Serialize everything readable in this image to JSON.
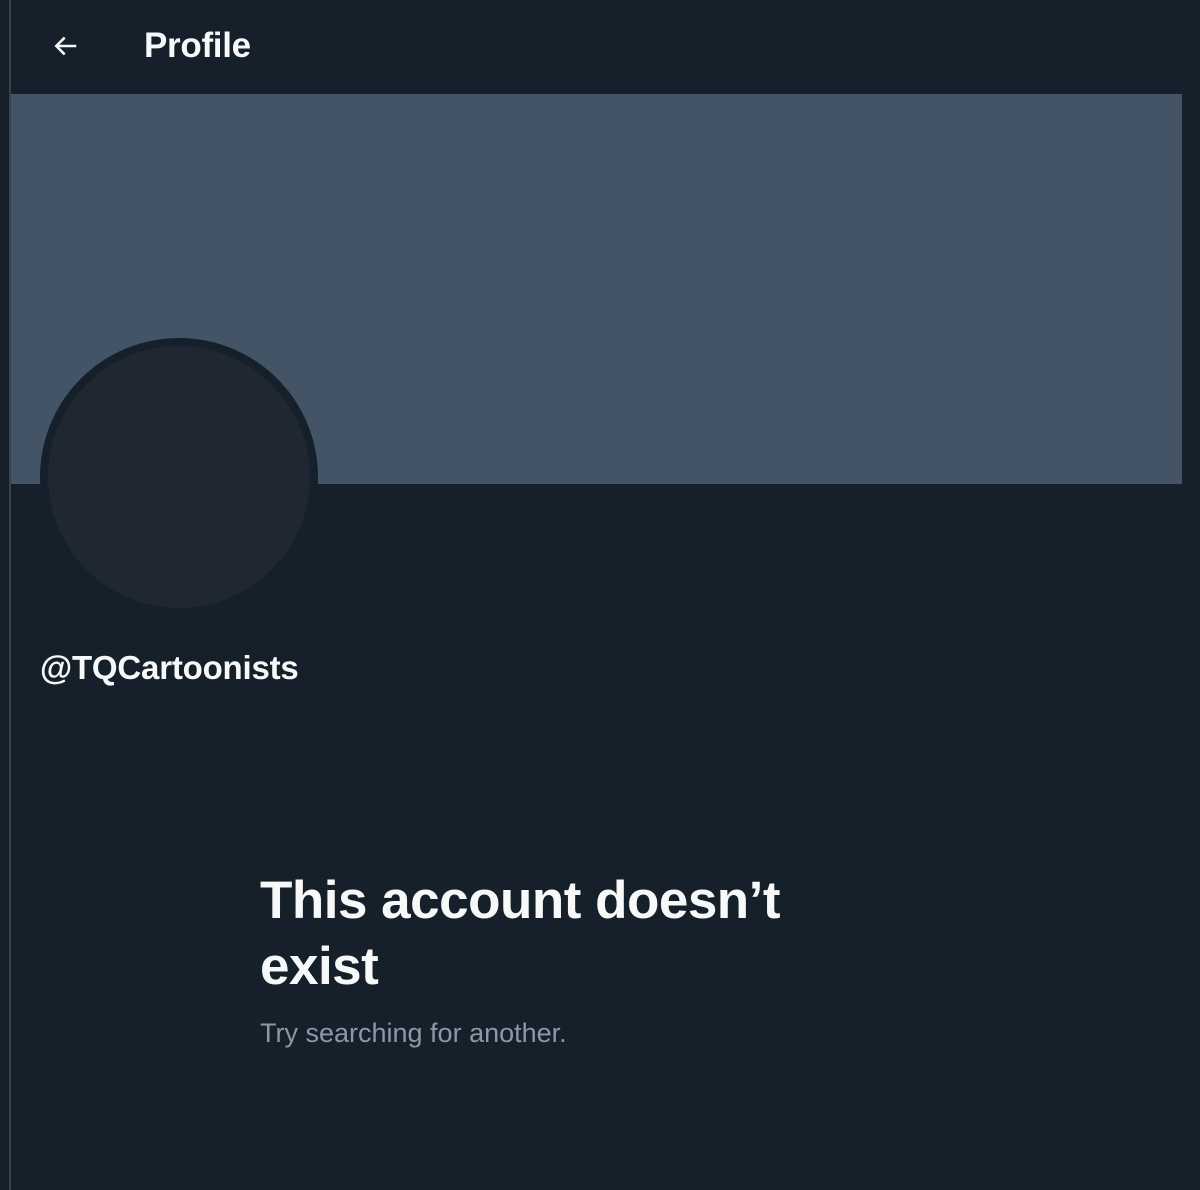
{
  "header": {
    "back_icon": "arrow-left-icon",
    "title": "Profile"
  },
  "profile": {
    "handle": "@TQCartoonists"
  },
  "empty_state": {
    "title": "This account doesn’t exist",
    "subtitle": "Try searching for another."
  },
  "colors": {
    "background": "#15202b",
    "banner": "#425466",
    "avatar": "#1e2732",
    "text_primary": "#f7f9f9",
    "text_secondary": "#8b98a5"
  }
}
